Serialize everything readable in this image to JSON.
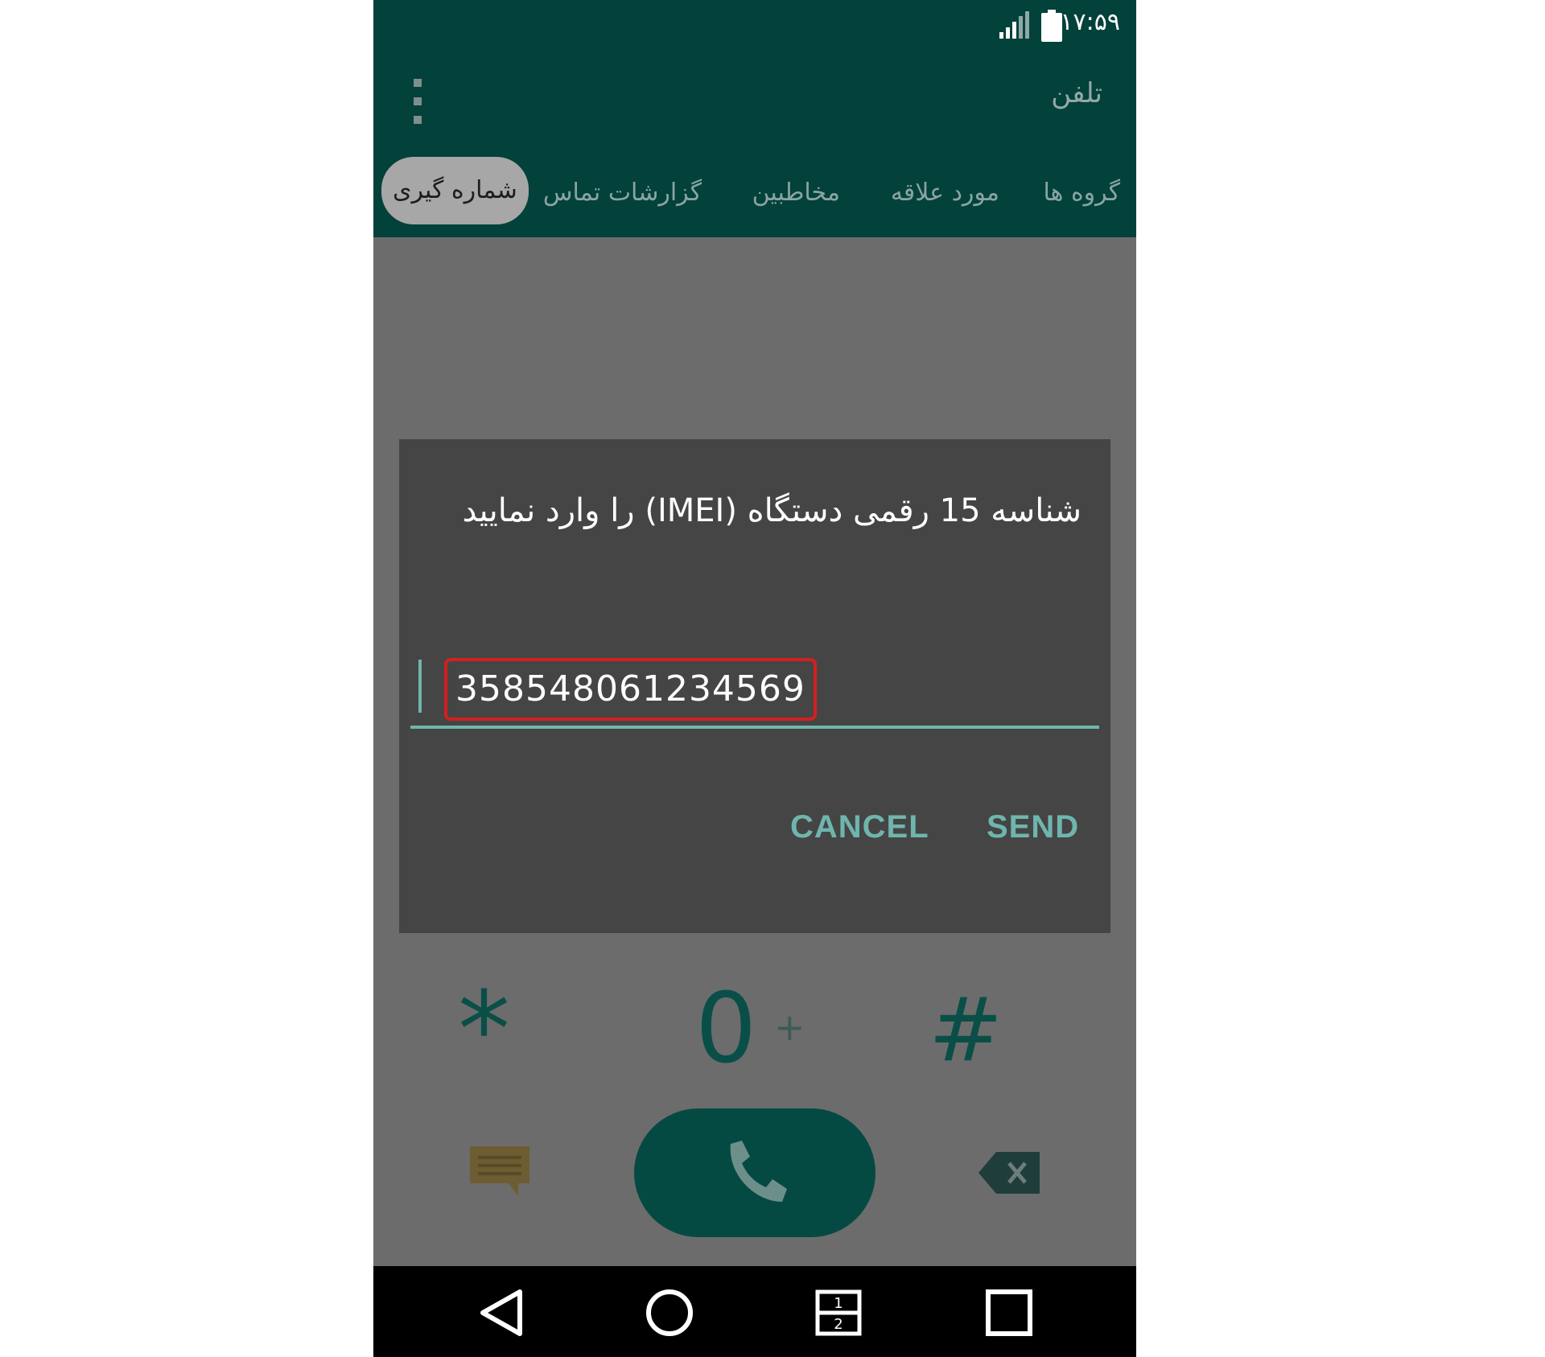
{
  "status_bar": {
    "time": "۱۷:۵۹",
    "icons": [
      "signal-icon",
      "battery-icon"
    ]
  },
  "app_bar": {
    "title": "تلفن",
    "menu_icon": "overflow-icon"
  },
  "tabs": [
    {
      "label": "گروه ها",
      "active": false
    },
    {
      "label": "مورد علاقه",
      "active": false
    },
    {
      "label": "مخاطبین",
      "active": false
    },
    {
      "label": "گزارشات تماس",
      "active": false
    },
    {
      "label": "شماره گیری",
      "active": true
    }
  ],
  "dialog": {
    "message": "شناسه 15 رقمی دستگاه (IMEI) را وارد نمایید",
    "input_value": "358548061234569",
    "cancel_label": "CANCEL",
    "send_label": "SEND"
  },
  "dialer": {
    "keys": {
      "star": "*",
      "zero": "0",
      "zero_sub": "+",
      "hash": "#"
    },
    "icons": [
      "message-icon",
      "phone-icon",
      "backspace-icon"
    ]
  },
  "nav_bar": {
    "icons": [
      "back-icon",
      "home-icon",
      "dual-window-icon",
      "recents-icon"
    ]
  },
  "colors": {
    "app_bar": "#03413b",
    "dim_background": "#6c6c6c",
    "dialog": "#454545",
    "accent": "#6fb5ad",
    "highlight_border": "#d41f1f"
  }
}
